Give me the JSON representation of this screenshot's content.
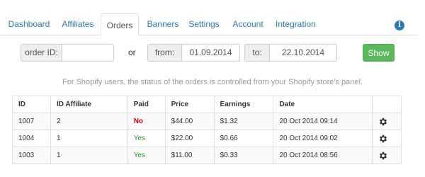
{
  "nav": {
    "tabs": [
      {
        "label": "Dashboard",
        "active": false
      },
      {
        "label": "Affiliates",
        "active": false
      },
      {
        "label": "Orders",
        "active": true
      },
      {
        "label": "Banners",
        "active": false
      },
      {
        "label": "Settings",
        "active": false
      },
      {
        "label": "Account",
        "active": false
      },
      {
        "label": "Integration",
        "active": false
      }
    ],
    "info_icon": "info-icon"
  },
  "filters": {
    "order_id_label": "order ID:",
    "order_id_value": "",
    "or_text": "or",
    "from_label": "from:",
    "from_value": "01.09.2014",
    "to_label": "to:",
    "to_value": "22.10.2014",
    "show_label": "Show"
  },
  "notice": "For Shopify users, the status of the orders is controlled from your Shopify store's panel.",
  "table": {
    "headers": [
      "ID",
      "ID Affiliate",
      "Paid",
      "Price",
      "Earnings",
      "Date",
      ""
    ],
    "rows": [
      {
        "id": "1007",
        "affiliate": "2",
        "paid": "No",
        "price": "$44.00",
        "earnings": "$1.32",
        "date": "20 Oct 2014 09:14"
      },
      {
        "id": "1004",
        "affiliate": "1",
        "paid": "Yes",
        "price": "$22.00",
        "earnings": "$0.66",
        "date": "20 Oct 2014 09:02"
      },
      {
        "id": "1003",
        "affiliate": "1",
        "paid": "Yes",
        "price": "$11.00",
        "earnings": "$0.33",
        "date": "20 Oct 2014 08:56"
      }
    ],
    "row_action_icon": "gear-icon"
  },
  "colors": {
    "link": "#2a7ab8",
    "show_button": "#5cb85c",
    "paid_no": "#e00000",
    "paid_yes": "#2d9a2d"
  }
}
